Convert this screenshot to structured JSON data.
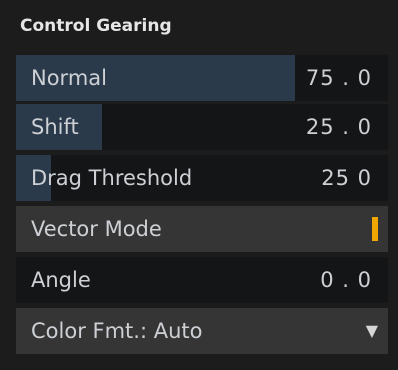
{
  "panel": {
    "title": "Control Gearing"
  },
  "rows": {
    "normal": {
      "label": "Normal",
      "value": "75 . 0",
      "fill_fraction": 0.75
    },
    "shift": {
      "label": "Shift",
      "value": "25 . 0",
      "fill_fraction": 0.23
    },
    "drag_threshold": {
      "label": "Drag Threshold",
      "value": "25 0",
      "fill_fraction": 0.095
    },
    "vector_mode": {
      "label": "Vector Mode",
      "toggle_color": "#f0a800"
    },
    "angle": {
      "label": "Angle",
      "value": "0 . 0"
    },
    "color_format": {
      "label": "Color Fmt.: Auto",
      "arrow": "▼"
    }
  },
  "colors": {
    "panel_background": "#1c1c1c",
    "slider_track": "#141516",
    "slider_fill": "#2a3a4b",
    "button_background": "#353535",
    "accent": "#f0a800"
  }
}
